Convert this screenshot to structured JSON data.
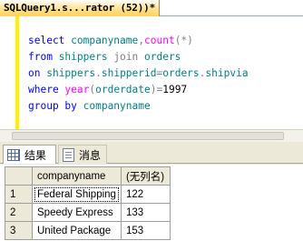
{
  "document_tab": {
    "title": "SQLQuery1.s...rator (52))*"
  },
  "editor": {
    "lines": [
      [
        {
          "t": "select ",
          "c": "kw"
        },
        {
          "t": "companyname",
          "c": "id"
        },
        {
          "t": ",",
          "c": "op"
        },
        {
          "t": "count",
          "c": "fn"
        },
        {
          "t": "(*)",
          "c": "op"
        }
      ],
      [
        {
          "t": "from ",
          "c": "kw"
        },
        {
          "t": "shippers ",
          "c": "id"
        },
        {
          "t": "join ",
          "c": "op"
        },
        {
          "t": "orders",
          "c": "id"
        }
      ],
      [
        {
          "t": "on ",
          "c": "kw"
        },
        {
          "t": "shippers",
          "c": "id"
        },
        {
          "t": ".",
          "c": "op"
        },
        {
          "t": "shipperid",
          "c": "id"
        },
        {
          "t": "=",
          "c": "op"
        },
        {
          "t": "orders",
          "c": "id"
        },
        {
          "t": ".",
          "c": "op"
        },
        {
          "t": "shipvia",
          "c": "id"
        }
      ],
      [
        {
          "t": "where ",
          "c": "kw"
        },
        {
          "t": "year",
          "c": "fn"
        },
        {
          "t": "(",
          "c": "op"
        },
        {
          "t": "orderdate",
          "c": "id"
        },
        {
          "t": ")=",
          "c": "op"
        },
        {
          "t": "1997",
          "c": "lit"
        }
      ],
      [
        {
          "t": "group by ",
          "c": "kw"
        },
        {
          "t": "companyname",
          "c": "id"
        }
      ]
    ]
  },
  "results_tabs": {
    "results_label": "结果",
    "messages_label": "消息"
  },
  "results_grid": {
    "columns": [
      "companyname",
      "(无列名)"
    ],
    "rows": [
      {
        "num": "1",
        "companyname": "Federal Shipping",
        "count": "122"
      },
      {
        "num": "2",
        "companyname": "Speedy Express",
        "count": "133"
      },
      {
        "num": "3",
        "companyname": "United Package",
        "count": "153"
      }
    ]
  },
  "colors": {
    "keyword": "#0000ff",
    "identifier": "#008080",
    "function": "#ff00ff",
    "operator": "#808080",
    "tab_accent": "#ffd25a",
    "change_bar": "#ffee00"
  }
}
